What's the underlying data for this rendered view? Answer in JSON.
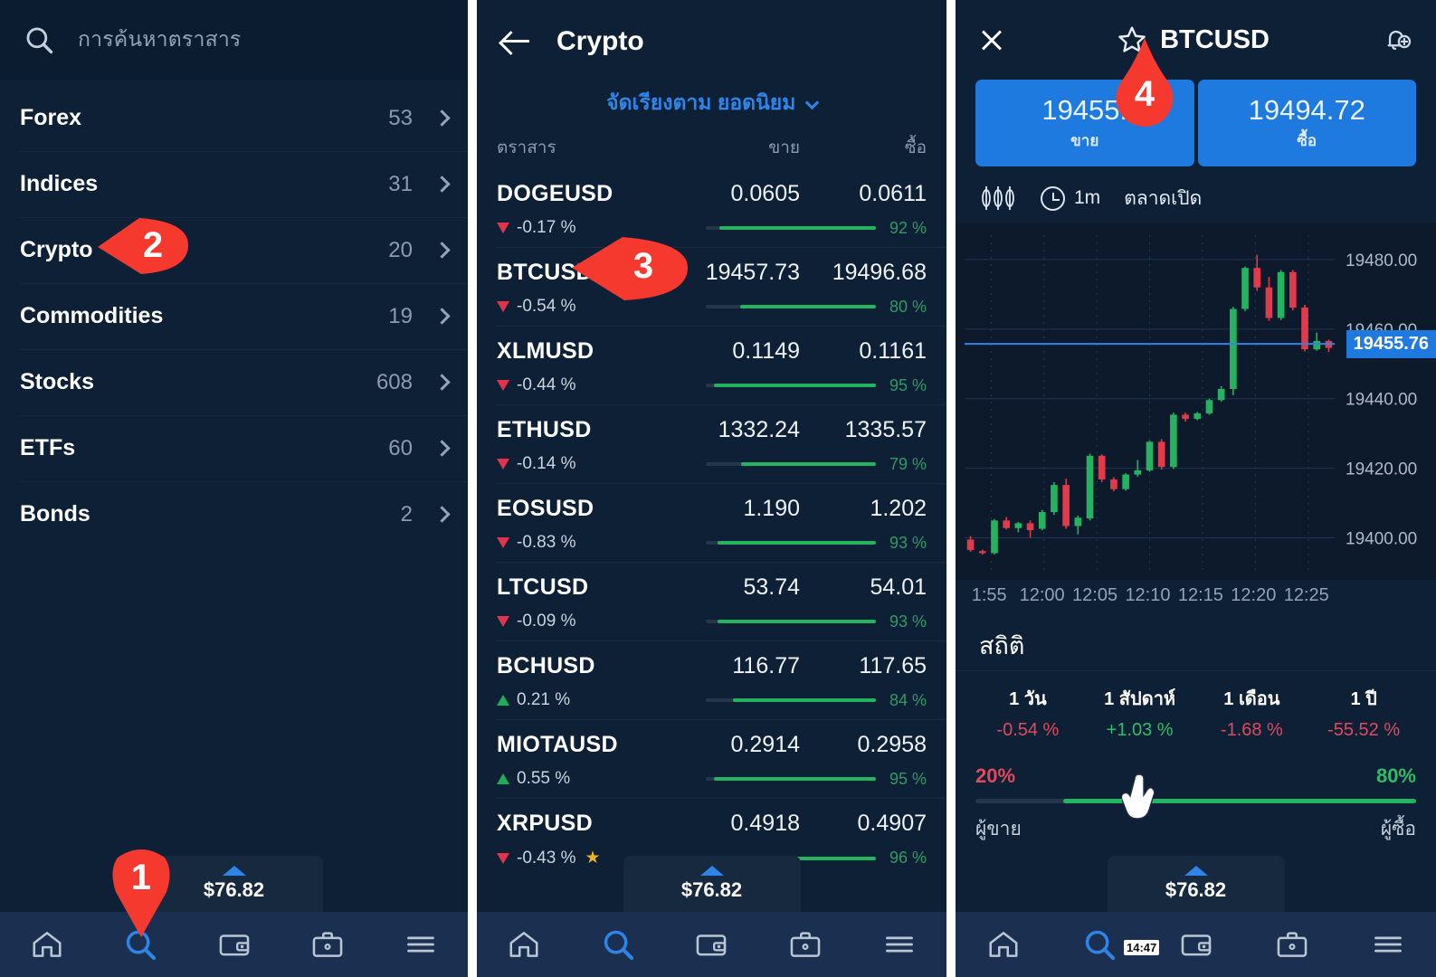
{
  "panel_search": {
    "search": {
      "placeholder": "การค้นหาตราสาร",
      "icon": "search-icon"
    },
    "categories": [
      {
        "label": "Forex",
        "count": "53"
      },
      {
        "label": "Indices",
        "count": "31"
      },
      {
        "label": "Crypto",
        "count": "20"
      },
      {
        "label": "Commodities",
        "count": "19"
      },
      {
        "label": "Stocks",
        "count": "608"
      },
      {
        "label": "ETFs",
        "count": "60"
      },
      {
        "label": "Bonds",
        "count": "2"
      }
    ],
    "balance": "$76.82",
    "callout": "1",
    "callout_category": "2"
  },
  "panel_crypto": {
    "header": {
      "title": "Crypto",
      "back_icon": "back-arrow-icon"
    },
    "sort": {
      "label": "จัดเรียงตาม ยอดนิยม",
      "caret_icon": "chevron-down-icon"
    },
    "columns": {
      "instrument": "ตราสาร",
      "sell": "ขาย",
      "buy": "ซื้อ"
    },
    "callout": "3",
    "balance": "$76.82",
    "rows": [
      {
        "symbol": "DOGEUSD",
        "sell": "0.0605",
        "buy": "0.0611",
        "change": "-0.17 %",
        "dir": "down",
        "sentiment": "92 %",
        "sentiment_pct": 92,
        "fav": false
      },
      {
        "symbol": "BTCUSD",
        "sell": "19457.73",
        "buy": "19496.68",
        "change": "-0.54 %",
        "dir": "down",
        "sentiment": "80 %",
        "sentiment_pct": 80,
        "fav": false
      },
      {
        "symbol": "XLMUSD",
        "sell": "0.1149",
        "buy": "0.1161",
        "change": "-0.44 %",
        "dir": "down",
        "sentiment": "95 %",
        "sentiment_pct": 95,
        "fav": false
      },
      {
        "symbol": "ETHUSD",
        "sell": "1332.24",
        "buy": "1335.57",
        "change": "-0.14 %",
        "dir": "down",
        "sentiment": "79 %",
        "sentiment_pct": 79,
        "fav": false
      },
      {
        "symbol": "EOSUSD",
        "sell": "1.190",
        "buy": "1.202",
        "change": "-0.83 %",
        "dir": "down",
        "sentiment": "93 %",
        "sentiment_pct": 93,
        "fav": false
      },
      {
        "symbol": "LTCUSD",
        "sell": "53.74",
        "buy": "54.01",
        "change": "-0.09 %",
        "dir": "down",
        "sentiment": "93 %",
        "sentiment_pct": 93,
        "fav": false
      },
      {
        "symbol": "BCHUSD",
        "sell": "116.77",
        "buy": "117.65",
        "change": "0.21 %",
        "dir": "up",
        "sentiment": "84 %",
        "sentiment_pct": 84,
        "fav": false
      },
      {
        "symbol": "MIOTAUSD",
        "sell": "0.2914",
        "buy": "0.2958",
        "change": "0.55 %",
        "dir": "up",
        "sentiment": "95 %",
        "sentiment_pct": 95,
        "fav": false
      },
      {
        "symbol": "XRPUSD",
        "sell": "0.4918",
        "buy": "0.4907",
        "change": "-0.43 %",
        "dir": "down",
        "sentiment": "96 %",
        "sentiment_pct": 96,
        "fav": true
      }
    ]
  },
  "panel_instrument": {
    "header": {
      "title": "BTCUSD",
      "close_icon": "close-icon",
      "star_icon": "star-icon",
      "bell_icon": "bell-add-icon"
    },
    "callout": "4",
    "sell_button": {
      "value": "19455.",
      "label": "ขาย"
    },
    "buy_button": {
      "value": "19494.72",
      "label": "ซื้อ"
    },
    "chart_toolbar": {
      "chart_type_icon": "candlestick-icon",
      "clock_icon": "clock-icon",
      "timeframe": "1m",
      "market_status": "ตลาดเปิด"
    },
    "current_price_tag": "19455.76",
    "stats": {
      "title": "สถิติ",
      "items": [
        {
          "label": "1 วัน",
          "value": "-0.54 %",
          "dir": "neg"
        },
        {
          "label": "1 สัปดาห์",
          "value": "+1.03 %",
          "dir": "pos"
        },
        {
          "label": "1 เดือน",
          "value": "-1.68 %",
          "dir": "neg"
        },
        {
          "label": "1 ปี",
          "value": "-55.52 %",
          "dir": "neg"
        }
      ]
    },
    "sentiment": {
      "sellers_pct": "20%",
      "buyers_pct": "80%",
      "sellers_label": "ผู้ขาย",
      "buyers_label": "ผู้ซื้อ",
      "buyers_value": 80
    },
    "balance": "$76.82",
    "time_chip": "14:47"
  },
  "bottom_nav": {
    "items": [
      {
        "icon": "home-icon",
        "active": false
      },
      {
        "icon": "search-icon",
        "active": true
      },
      {
        "icon": "wallet-icon",
        "active": false
      },
      {
        "icon": "briefcase-icon",
        "active": false
      },
      {
        "icon": "menu-icon",
        "active": false
      }
    ]
  },
  "colors": {
    "accent_blue": "#2f84e8",
    "up_green": "#22b45e",
    "down_red": "#e0344b",
    "pin_red": "#f5392f",
    "bg_dark": "#0e2036"
  },
  "chart_data": {
    "type": "candlestick",
    "title": "BTCUSD 1m",
    "ylabel": "",
    "xlabel": "",
    "ylim": [
      19390,
      19487
    ],
    "yticks": [
      "19480.00",
      "19460.00",
      "19440.00",
      "19420.00",
      "19400.00"
    ],
    "xticks": [
      "1:55",
      "12:00",
      "12:05",
      "12:10",
      "12:15",
      "12:20",
      "12:25"
    ],
    "current_price": 19455.76,
    "grid": true,
    "candles": [
      {
        "o": 19399.5,
        "h": 19400.5,
        "l": 19396.0,
        "c": 19396.5,
        "dir": "down"
      },
      {
        "o": 19396.2,
        "h": 19396.6,
        "l": 19395.2,
        "c": 19395.6,
        "dir": "down"
      },
      {
        "o": 19395.6,
        "h": 19405.4,
        "l": 19395.2,
        "c": 19405.0,
        "dir": "up"
      },
      {
        "o": 19405.0,
        "h": 19406.0,
        "l": 19402.4,
        "c": 19402.8,
        "dir": "down"
      },
      {
        "o": 19402.8,
        "h": 19404.6,
        "l": 19401.6,
        "c": 19404.2,
        "dir": "up"
      },
      {
        "o": 19404.2,
        "h": 19405.0,
        "l": 19400.0,
        "c": 19402.2,
        "dir": "down"
      },
      {
        "o": 19402.6,
        "h": 19408.0,
        "l": 19402.2,
        "c": 19407.4,
        "dir": "up"
      },
      {
        "o": 19407.4,
        "h": 19416.0,
        "l": 19406.6,
        "c": 19415.2,
        "dir": "up"
      },
      {
        "o": 19415.2,
        "h": 19417.0,
        "l": 19402.6,
        "c": 19403.4,
        "dir": "down"
      },
      {
        "o": 19403.4,
        "h": 19406.4,
        "l": 19401.0,
        "c": 19405.8,
        "dir": "up"
      },
      {
        "o": 19405.6,
        "h": 19424.2,
        "l": 19405.0,
        "c": 19423.6,
        "dir": "up"
      },
      {
        "o": 19423.6,
        "h": 19424.0,
        "l": 19416.0,
        "c": 19416.8,
        "dir": "down"
      },
      {
        "o": 19416.8,
        "h": 19417.4,
        "l": 19413.4,
        "c": 19414.0,
        "dir": "down"
      },
      {
        "o": 19414.0,
        "h": 19418.6,
        "l": 19413.6,
        "c": 19418.2,
        "dir": "up"
      },
      {
        "o": 19418.2,
        "h": 19422.4,
        "l": 19417.6,
        "c": 19419.4,
        "dir": "up"
      },
      {
        "o": 19419.4,
        "h": 19428.0,
        "l": 19419.0,
        "c": 19427.6,
        "dir": "up"
      },
      {
        "o": 19427.6,
        "h": 19428.4,
        "l": 19419.6,
        "c": 19420.4,
        "dir": "down"
      },
      {
        "o": 19420.4,
        "h": 19436.0,
        "l": 19419.8,
        "c": 19435.4,
        "dir": "up"
      },
      {
        "o": 19435.4,
        "h": 19436.0,
        "l": 19433.4,
        "c": 19434.2,
        "dir": "down"
      },
      {
        "o": 19434.2,
        "h": 19436.2,
        "l": 19433.8,
        "c": 19435.8,
        "dir": "up"
      },
      {
        "o": 19435.8,
        "h": 19440.0,
        "l": 19435.4,
        "c": 19439.6,
        "dir": "up"
      },
      {
        "o": 19439.6,
        "h": 19443.6,
        "l": 19439.2,
        "c": 19442.8,
        "dir": "up"
      },
      {
        "o": 19442.8,
        "h": 19466.4,
        "l": 19441.0,
        "c": 19465.8,
        "dir": "up"
      },
      {
        "o": 19465.8,
        "h": 19478.0,
        "l": 19465.2,
        "c": 19477.6,
        "dir": "up"
      },
      {
        "o": 19477.6,
        "h": 19481.4,
        "l": 19471.0,
        "c": 19472.0,
        "dir": "down"
      },
      {
        "o": 19472.0,
        "h": 19475.0,
        "l": 19462.4,
        "c": 19463.2,
        "dir": "down"
      },
      {
        "o": 19463.2,
        "h": 19477.0,
        "l": 19462.6,
        "c": 19476.4,
        "dir": "up"
      },
      {
        "o": 19476.4,
        "h": 19477.0,
        "l": 19465.4,
        "c": 19466.2,
        "dir": "down"
      },
      {
        "o": 19466.2,
        "h": 19467.0,
        "l": 19453.6,
        "c": 19454.2,
        "dir": "down"
      },
      {
        "o": 19454.2,
        "h": 19459.0,
        "l": 19453.8,
        "c": 19456.6,
        "dir": "up"
      },
      {
        "o": 19456.6,
        "h": 19457.0,
        "l": 19453.4,
        "c": 19454.6,
        "dir": "down"
      }
    ]
  }
}
